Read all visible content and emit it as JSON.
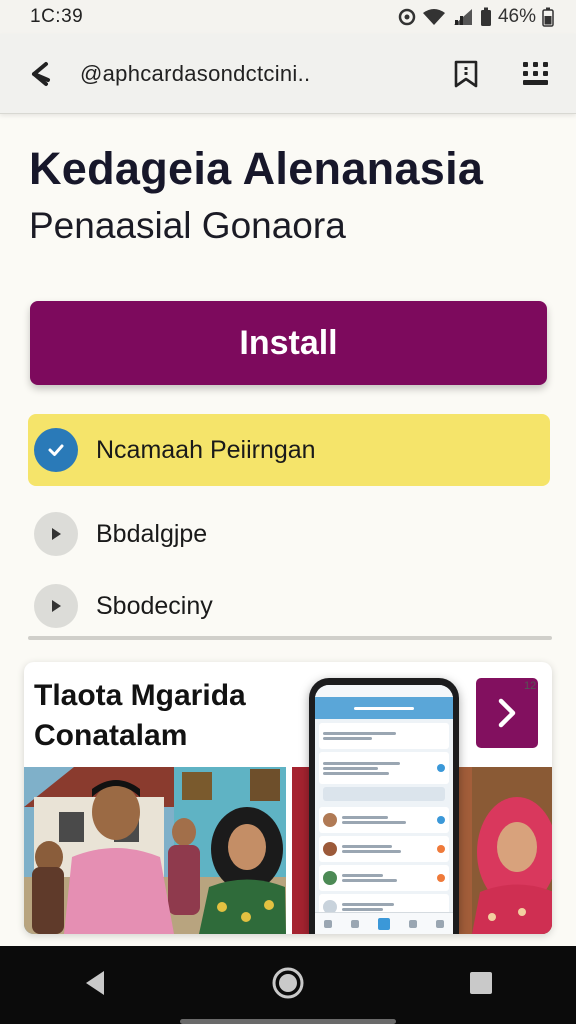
{
  "status_bar": {
    "time": "1C:39",
    "battery": "46%"
  },
  "url_bar": {
    "url": "@aphcardasondctcini.."
  },
  "app": {
    "title": "Kedageia Alenanasia",
    "subtitle": "Penaasial Gonaora",
    "install_label": "Install"
  },
  "options": [
    {
      "label": "Ncamaah Peiirngan",
      "selected": true
    },
    {
      "label": "Bbdalgjpe",
      "selected": false
    },
    {
      "label": "Sbodeciny",
      "selected": false
    }
  ],
  "promo": {
    "title": "Tlaota Mgarida Conatalam",
    "badge": "12"
  },
  "colors": {
    "accent": "#7d0a5d",
    "highlight": "#f5e46a",
    "check": "#2a7ab8"
  }
}
